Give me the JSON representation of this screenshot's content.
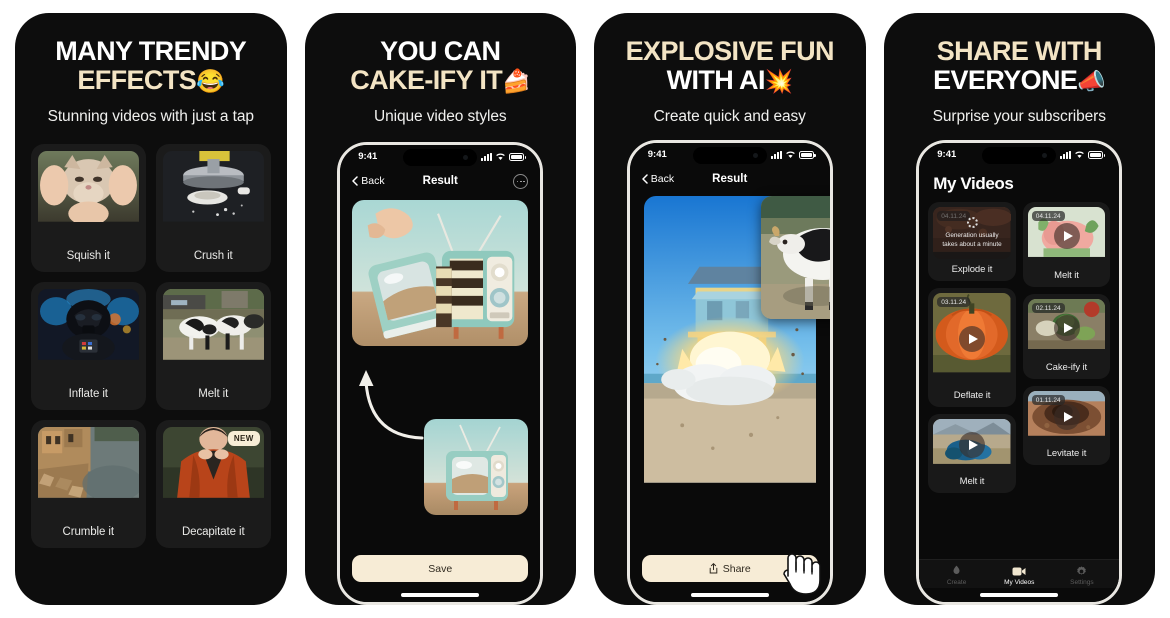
{
  "panels": [
    {
      "id": "many-trendy-effects",
      "headline_line1": "MANY TRENDY",
      "headline_line2": "EFFECTS",
      "headline_emoji": "😂",
      "subhead": "Stunning videos with just a tap",
      "effects": [
        {
          "label": "Squish it",
          "badge": ""
        },
        {
          "label": "Crush it",
          "badge": ""
        },
        {
          "label": "Inflate it",
          "badge": ""
        },
        {
          "label": "Melt it",
          "badge": ""
        },
        {
          "label": "Crumble it",
          "badge": ""
        },
        {
          "label": "Decapitate it",
          "badge": "NEW"
        }
      ]
    },
    {
      "id": "cake-ify-it",
      "headline_line1": "YOU CAN",
      "headline_line2": "CAKE-IFY IT",
      "headline_emoji": "🍰",
      "subhead": "Unique video styles",
      "status_time": "9:41",
      "nav_back": "Back",
      "nav_title": "Result",
      "primary_button": "Save"
    },
    {
      "id": "explosive-fun-with-ai",
      "headline_line1": "EXPLOSIVE FUN",
      "headline_line2": "WITH AI",
      "headline_emoji": "💥",
      "subhead": "Create quick and easy",
      "status_time": "9:41",
      "nav_back": "Back",
      "nav_title": "Result",
      "primary_button": "Share"
    },
    {
      "id": "share-with-everyone",
      "headline_line1": "SHARE WITH",
      "headline_line2": "EVERYONE",
      "headline_emoji": "📣",
      "subhead": "Surprise your subscribers",
      "status_time": "9:41",
      "screen_title": "My Videos",
      "videos": [
        {
          "label": "Explode it",
          "date": "04.11.24",
          "state": "generating",
          "generating_text": "Generation usually takes about a minute"
        },
        {
          "label": "Melt it",
          "date": "04.11.24",
          "state": "ready"
        },
        {
          "label": "Deflate it",
          "date": "03.11.24",
          "state": "ready"
        },
        {
          "label": "Cake-ify it",
          "date": "02.11.24",
          "state": "ready"
        },
        {
          "label": "Melt it",
          "date": "",
          "state": "ready"
        },
        {
          "label": "Levitate it",
          "date": "01.11.24",
          "state": "ready"
        }
      ],
      "tabs": [
        {
          "label": "Create",
          "icon": "flame-icon",
          "active": false
        },
        {
          "label": "My Videos",
          "icon": "video-icon",
          "active": true
        },
        {
          "label": "Settings",
          "icon": "gear-icon",
          "active": false
        }
      ]
    }
  ],
  "colors": {
    "panel_bg": "#0d0d0d",
    "cream": "#f3e4c4",
    "button_cream": "#f7ecd6",
    "page_bg": "#ffffff"
  }
}
